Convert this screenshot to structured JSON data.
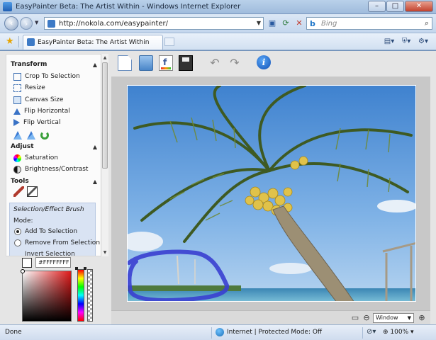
{
  "window": {
    "title": "EasyPainter Beta: The Artist Within - Windows Internet Explorer",
    "minimize": "–",
    "maximize": "□",
    "close": "✕"
  },
  "address": {
    "url": "http://nokola.com/easypainter/",
    "search_placeholder": "Bing"
  },
  "tab": {
    "label": "EasyPainter Beta: The Artist Within"
  },
  "sidebar": {
    "transform": {
      "heading": "Transform",
      "items": [
        {
          "label": "Crop To Selection",
          "icon": "crop-icon"
        },
        {
          "label": "Resize",
          "icon": "resize-icon"
        },
        {
          "label": "Canvas Size",
          "icon": "canvas-size-icon"
        },
        {
          "label": "Flip Horizontal",
          "icon": "flip-horizontal-icon"
        },
        {
          "label": "Flip Vertical",
          "icon": "flip-vertical-icon"
        }
      ]
    },
    "adjust": {
      "heading": "Adjust",
      "items": [
        {
          "label": "Saturation",
          "icon": "saturation-icon"
        },
        {
          "label": "Brightness/Contrast",
          "icon": "brightness-contrast-icon"
        }
      ]
    },
    "tools": {
      "heading": "Tools",
      "brush_title": "Selection/Effect Brush",
      "mode_label": "Mode:",
      "modes": [
        "Add To Selection",
        "Remove From Selection",
        "Invert Selection"
      ],
      "selected_mode": "Add To Selection"
    }
  },
  "color_picker": {
    "hex_value": "#FFFFFFFF",
    "current_color": "#FFFFFF"
  },
  "canvas": {
    "zoom_mode": "Window"
  },
  "statusbar": {
    "status": "Done",
    "zone": "Internet | Protected Mode: Off",
    "zoom": "100%"
  }
}
